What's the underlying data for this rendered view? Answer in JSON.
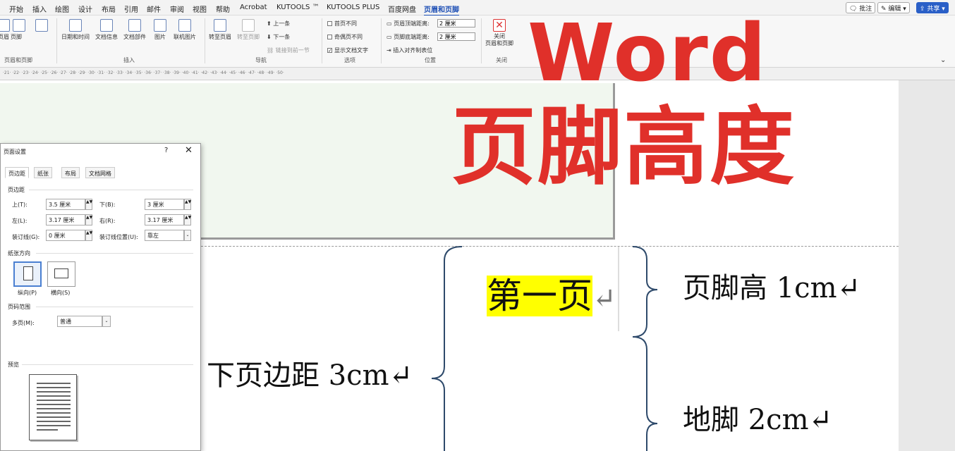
{
  "menu": {
    "tabs": [
      "开始",
      "插入",
      "绘图",
      "设计",
      "布局",
      "引用",
      "邮件",
      "审阅",
      "视图",
      "帮助",
      "Acrobat",
      "KUTOOLS ™",
      "KUTOOLS PLUS",
      "百度网盘",
      "页眉和页脚"
    ],
    "comment": "批注",
    "edit": "编辑",
    "share": "共享"
  },
  "ribbon": {
    "g1": {
      "header": "页眉",
      "footer": "页脚",
      "label": "页眉和页脚"
    },
    "g2": {
      "datetime": "日期和时间",
      "docinfo": "文档信息",
      "docparts": "文档部件",
      "picture": "图片",
      "online_pic": "联机图片",
      "label": "插入"
    },
    "g3": {
      "goto_header": "转至页眉",
      "goto_footer": "转至页脚",
      "prev": "上一条",
      "next": "下一条",
      "link_prev": "链接到前一节",
      "label": "导航"
    },
    "g4": {
      "first_diff": "首页不同",
      "odd_even": "奇偶页不同",
      "show_text": "显示文档文字",
      "label": "选项"
    },
    "g5": {
      "header_top": "页眉顶端距离:",
      "footer_bottom": "页脚底端距离:",
      "header_val": "2 厘米",
      "footer_val": "2 厘米",
      "align_tab": "插入对齐制表位",
      "label": "位置"
    },
    "g6": {
      "close": "关闭\n页眉和页脚",
      "label": "关闭"
    }
  },
  "ruler": "·21· ·22· ·23· ·24· ·25· ·26· ·27· ·28· ·29· ·30· ·31· ·32· ·33· ·34· ·35· ·36· ·37· ·38· ·39· ·40· ·41· ·42· ·43· ·44· ·45· ·46· ·47· ·48· ·49· ·50·",
  "overlay": {
    "title_en": "Word",
    "title_cn": "页脚高度"
  },
  "doc": {
    "first_page": "第一页",
    "return_mark": "↵",
    "footer_height": "页脚高 1cm↵",
    "bottom_margin": "下页边距 3cm↵",
    "footer_distance": "地脚 2cm↵"
  },
  "dialog": {
    "title": "页面设置",
    "help": "?",
    "close": "✕",
    "tabs": [
      "页边距",
      "纸张",
      "布局",
      "文档网格"
    ],
    "margins_label": "页边距",
    "top_label": "上(T):",
    "top_val": "3.5 厘米",
    "bottom_label": "下(B):",
    "bottom_val": "3 厘米",
    "left_label": "左(L):",
    "left_val": "3.17 厘米",
    "right_label": "右(R):",
    "right_val": "3.17 厘米",
    "gutter_label": "装订线(G):",
    "gutter_val": "0 厘米",
    "gutter_pos_label": "装订线位置(U):",
    "gutter_pos_val": "靠左",
    "orient_label": "纸张方向",
    "portrait": "纵向(P)",
    "landscape": "横向(S)",
    "pages_label": "页码范围",
    "multi_label": "多页(M):",
    "multi_val": "普通",
    "preview_label": "预览"
  }
}
